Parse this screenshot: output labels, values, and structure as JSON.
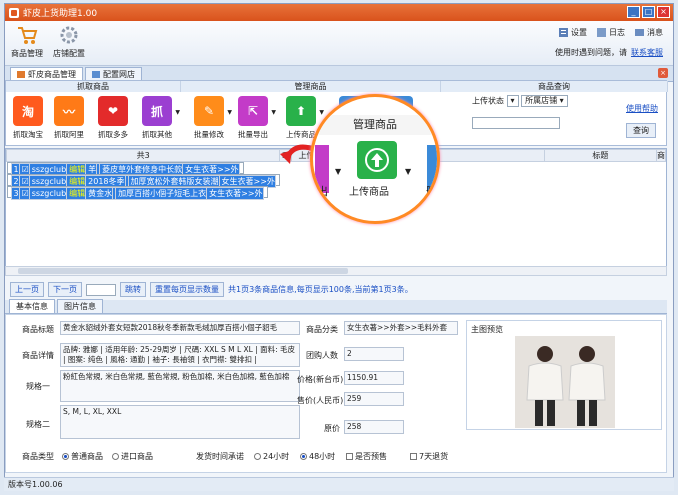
{
  "window": {
    "title": "虾皮上货助理1.00"
  },
  "topbar": {
    "product_mgmt": "商品管理",
    "shop_config": "店铺配置",
    "settings": "设置",
    "log": "日志",
    "message": "消息",
    "hint": "使用时遇到问题，请",
    "hint_link": "联系客服"
  },
  "tabs": [
    {
      "label": "虾皮商品管理"
    },
    {
      "label": "配置网店"
    }
  ],
  "ribbon": {
    "group_grab": "抓取商品",
    "group_manage": "管理商品",
    "group_query": "商品查询",
    "grab_btns": [
      {
        "label": "抓取淘宝",
        "glyph": "淘",
        "color": "#ff5a1e"
      },
      {
        "label": "抓取阿里",
        "glyph": "〰",
        "color": "#ff7a17"
      },
      {
        "label": "抓取多多",
        "glyph": "❤",
        "color": "#e32b2b"
      },
      {
        "label": "抓取其他",
        "glyph": "抓",
        "color": "#9b3fd1"
      }
    ],
    "manage_btns": [
      {
        "label": "批量修改",
        "color": "#ff8c1a"
      },
      {
        "label": "批量导出",
        "color": "#c33bc8"
      },
      {
        "label": "上传商品",
        "color": "#29b14a"
      },
      {
        "label": "",
        "color": "#3b8ad8"
      },
      {
        "label": "",
        "color": "#3b8ad8"
      }
    ],
    "upload_status": "上传状态",
    "store": "所属店铺",
    "help": "使用帮助",
    "query_btn": "查询"
  },
  "zoom": {
    "title": "管理商品",
    "label": "上传商品",
    "left_text": "出",
    "right_text": "删"
  },
  "grid": {
    "headers": [
      "共3",
      "☑",
      "上传店铺",
      "编辑",
      "信息",
      "",
      "",
      "",
      "",
      "",
      "标题",
      "商"
    ],
    "rows": [
      {
        "num": "1",
        "shop": "sszgclub",
        "edit": "编辑",
        "info": "羊",
        "title": "菱皮草外套修身中长款",
        "cat": "女生衣著>>外"
      },
      {
        "num": "2",
        "shop": "sszgclub",
        "edit": "编辑",
        "info": "2018冬季",
        "title": "加厚宽松外套韩版女装潮",
        "cat": "女生衣著>>外"
      },
      {
        "num": "3",
        "shop": "sszgclub",
        "edit": "编辑",
        "info": "黄金水",
        "title": "加厚百搭小個子短毛上衣",
        "cat": "女生衣著>>外"
      }
    ]
  },
  "pager": {
    "prev": "上一页",
    "next": "下一页",
    "jump": "跳转",
    "refresh": "重置每页显示数量",
    "info": "共1页3条商品信息,每页显示100条,当前第1页3条。"
  },
  "detail": {
    "tabs": [
      "基本信息",
      "图片信息"
    ],
    "title_label": "商品标题",
    "title": "黄金水貂绒外套女短款2018秋冬季新款毛绒加厚百搭小個子貂毛",
    "desc_label": "商品详情",
    "desc": "品牌: 雅娜 | 适用年龄: 25-29周岁 | 尺碼: XXL S M L XL | 面料: 毛皮 | 图案: 纯色 | 風格: 通勤 | 袖子: 長袖領 | 衣門襟: 雙排扣 |",
    "spec1_label": "规格一",
    "spec1": "粉紅色常規, 米白色常規, 藍色常規, 粉色加棉, 米白色加棉, 藍色加棉",
    "spec2_label": "规格二",
    "spec2": "S, M, L, XL, XXL",
    "cat_label": "商品分类",
    "cat": "女生衣著>>外套>>毛料外套",
    "group_label": "团购人数",
    "group": "2",
    "price_twd_label": "价格(新台币)",
    "price_twd": "1150.91",
    "price_cny_label": "售价(人民币)",
    "price_cny": "259",
    "orig_label": "原价",
    "orig": "258",
    "preview_label": "主图预览",
    "type_label": "商品类型",
    "type_normal": "普通商品",
    "type_import": "进口商品",
    "ship_label": "发货时间承诺",
    "ship_24": "24小时",
    "ship_48": "48小时",
    "presale": "是否预售",
    "return7": "7天退货"
  },
  "status": {
    "version": "版本号1.00.06"
  }
}
